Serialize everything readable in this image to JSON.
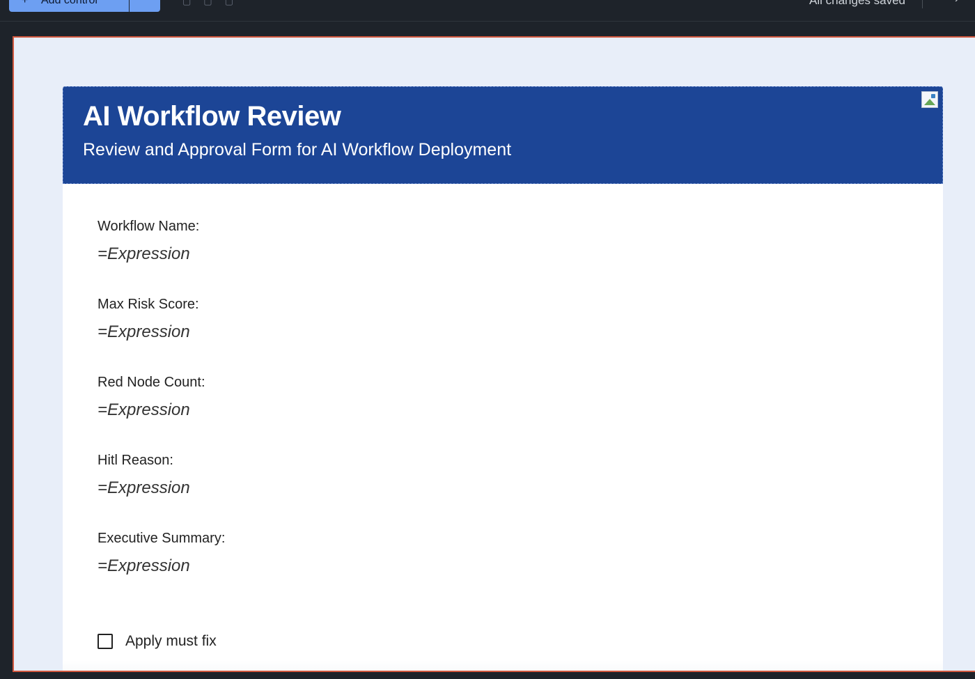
{
  "toolbar": {
    "add_control_label": "Add control",
    "add_control_icon": "plus-icon",
    "save_status": "All changes saved"
  },
  "form": {
    "title": "AI Workflow Review",
    "subtitle": "Review and Approval Form for AI Workflow Deployment",
    "header_image_icon": "broken-image-icon",
    "fields": [
      {
        "label": "Workflow Name:",
        "value": "=Expression"
      },
      {
        "label": "Max Risk Score:",
        "value": "=Expression"
      },
      {
        "label": "Red Node Count:",
        "value": "=Expression"
      },
      {
        "label": "Hitl Reason:",
        "value": "=Expression"
      },
      {
        "label": "Executive Summary:",
        "value": "=Expression"
      }
    ],
    "checkbox": {
      "label": "Apply must fix",
      "checked": false
    }
  },
  "colors": {
    "header_bg": "#1c4596",
    "canvas_bg": "#e8eef9",
    "selection_border": "#d2583f",
    "add_button": "#6d9ff2"
  }
}
